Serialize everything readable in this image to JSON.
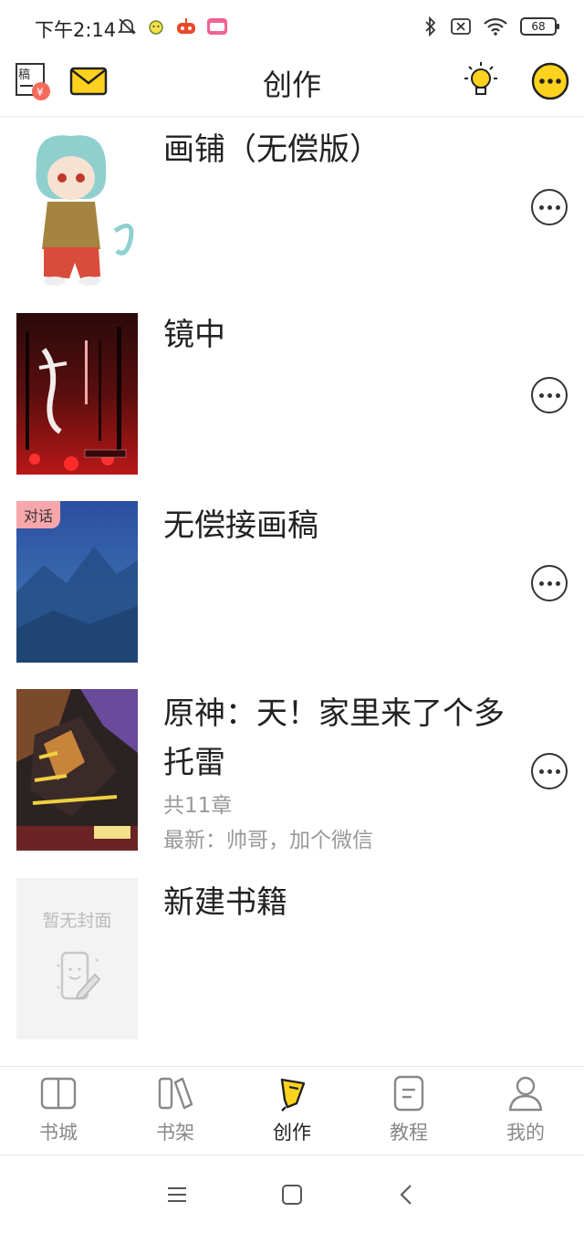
{
  "status_bar": {
    "time": "下午2:14",
    "battery": "68"
  },
  "header": {
    "title": "创作"
  },
  "books": [
    {
      "title": "画铺（无偿版）",
      "badge": "",
      "chapters": "",
      "latest": ""
    },
    {
      "title": "镜中",
      "badge": "",
      "chapters": "",
      "latest": ""
    },
    {
      "title": "无偿接画稿",
      "badge": "对话",
      "chapters": "",
      "latest": ""
    },
    {
      "title": "原神：天！家里来了个多托雷",
      "badge": "",
      "chapters": "共11章",
      "latest": "最新：帅哥，加个微信"
    },
    {
      "title": "新建书籍",
      "placeholder": "暂无封面"
    }
  ],
  "tabs": [
    {
      "label": "书城",
      "icon": "book-open-icon",
      "active": false
    },
    {
      "label": "书架",
      "icon": "bookshelf-icon",
      "active": false
    },
    {
      "label": "创作",
      "icon": "pen-icon",
      "active": true
    },
    {
      "label": "教程",
      "icon": "tutorial-icon",
      "active": false
    },
    {
      "label": "我的",
      "icon": "user-icon",
      "active": false
    }
  ],
  "colors": {
    "accent_yellow": "#ffd21f",
    "text_primary": "#222222",
    "text_secondary": "#999999",
    "badge_bg": "#f7a7ab"
  }
}
